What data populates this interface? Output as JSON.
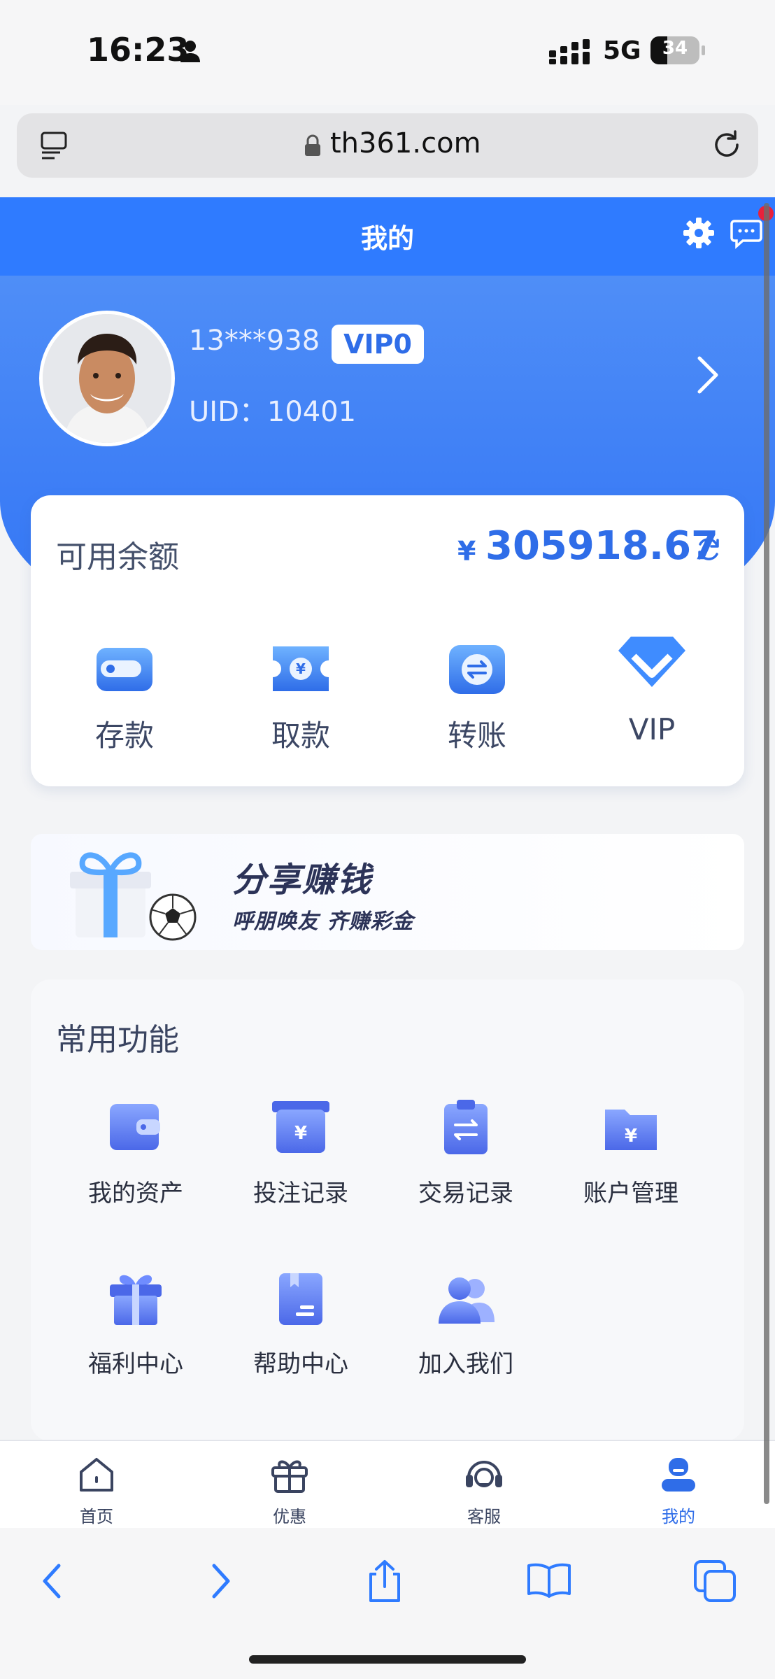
{
  "status_bar": {
    "time": "16:23",
    "network": "5G",
    "battery": "34",
    "battery_level": 0.34
  },
  "browser": {
    "url": "th361.com"
  },
  "header": {
    "title": "我的"
  },
  "profile": {
    "username": "13***938",
    "vip_level": "VIP0",
    "uid": "UID：10401"
  },
  "balance": {
    "label": "可用余额",
    "currency": "¥",
    "amount": "305918.67",
    "actions": [
      {
        "label": "存款",
        "icon": "wallet-icon"
      },
      {
        "label": "取款",
        "icon": "withdraw-ticket-icon"
      },
      {
        "label": "转账",
        "icon": "transfer-icon"
      },
      {
        "label": "VIP",
        "icon": "vip-chevron-icon"
      }
    ]
  },
  "banner": {
    "title": "分享赚钱",
    "subtitle": "呼朋唤友 齐赚彩金"
  },
  "functions": {
    "title": "常用功能",
    "items": [
      {
        "label": "我的资产",
        "icon": "assets-wallet-icon"
      },
      {
        "label": "投注记录",
        "icon": "bet-record-icon"
      },
      {
        "label": "交易记录",
        "icon": "transaction-record-icon"
      },
      {
        "label": "账户管理",
        "icon": "account-folder-icon"
      },
      {
        "label": "福利中心",
        "icon": "gift-icon"
      },
      {
        "label": "帮助中心",
        "icon": "help-book-icon"
      },
      {
        "label": "加入我们",
        "icon": "people-icon"
      }
    ]
  },
  "tabs": [
    {
      "label": "首页",
      "icon": "home-icon",
      "active": false
    },
    {
      "label": "优惠",
      "icon": "gift-tab-icon",
      "active": false
    },
    {
      "label": "客服",
      "icon": "headset-icon",
      "active": false
    },
    {
      "label": "我的",
      "icon": "profile-icon",
      "active": true
    }
  ],
  "colors": {
    "primary": "#2f7bff",
    "accent_text": "#2f6de8",
    "background": "#f3f4f6",
    "notification": "#e8213b"
  }
}
